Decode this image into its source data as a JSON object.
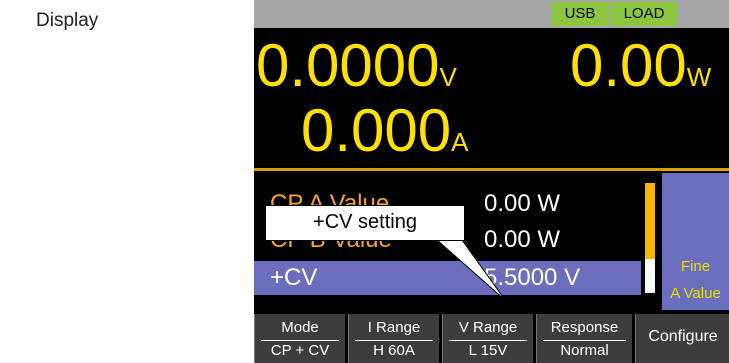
{
  "label": "Display",
  "status": {
    "usb": "USB",
    "load": "LOAD"
  },
  "measure": {
    "voltage": {
      "value": "0.0000",
      "unit": "V"
    },
    "power": {
      "value": "0.00",
      "unit": "W"
    },
    "current": {
      "value": "0.000",
      "unit": "A"
    }
  },
  "rows": [
    {
      "name": "CP A Value",
      "value": "0.00 W"
    },
    {
      "name": "CP B Value",
      "value": "0.00 W"
    },
    {
      "name": "+CV",
      "value": "5.5000 V"
    }
  ],
  "side": {
    "line1": "Fine",
    "line2": "A Value"
  },
  "softkeys": [
    {
      "top": "Mode",
      "bottom": "CP + CV"
    },
    {
      "top": "I Range",
      "bottom": "H 60A"
    },
    {
      "top": "V Range",
      "bottom": "L 15V"
    },
    {
      "top": "Response",
      "bottom": "Normal"
    },
    {
      "single": "Configure"
    }
  ],
  "callout": "+CV setting",
  "colors": {
    "measure": "#ffe000",
    "highlight": "#6a6ebd",
    "status": "#8cc63f",
    "accent": "#f5a623"
  }
}
